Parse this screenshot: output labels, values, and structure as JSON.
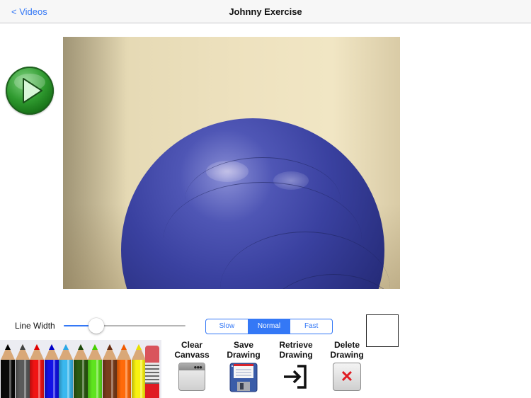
{
  "navbar": {
    "back_label": "< Videos",
    "title": "Johnny Exercise"
  },
  "video": {
    "play_icon": "play-icon",
    "description": "Blue exercise ball against beige wall"
  },
  "controls": {
    "line_width_label": "Line Width",
    "line_width_value": 0.27,
    "speed_options": [
      "Slow",
      "Normal",
      "Fast"
    ],
    "speed_selected": "Normal",
    "current_color": "#ffffff"
  },
  "palette": {
    "pencils": [
      {
        "name": "black",
        "color": "#0a0a0a",
        "tip": "#000000"
      },
      {
        "name": "gray",
        "color": "#5a5a5a",
        "tip": "#444444"
      },
      {
        "name": "red",
        "color": "#f01414",
        "tip": "#e00000"
      },
      {
        "name": "blue",
        "color": "#1212e6",
        "tip": "#0000c8"
      },
      {
        "name": "light-blue",
        "color": "#3ab8ef",
        "tip": "#2aa8e8"
      },
      {
        "name": "dark-green",
        "color": "#2b5a12",
        "tip": "#1e4a0a"
      },
      {
        "name": "light-green",
        "color": "#5ee41e",
        "tip": "#45d000"
      },
      {
        "name": "brown",
        "color": "#7a3c1c",
        "tip": "#6a2e12"
      },
      {
        "name": "orange",
        "color": "#ff6a0a",
        "tip": "#f05a00"
      },
      {
        "name": "yellow",
        "color": "#f8f010",
        "tip": "#e8e000"
      }
    ],
    "eraser_icon": "eraser-icon"
  },
  "actions": [
    {
      "line1": "Clear",
      "line2": "Canvass",
      "icon": "window-icon"
    },
    {
      "line1": "Save",
      "line2": "Drawing",
      "icon": "floppy-disk-icon"
    },
    {
      "line1": "Retrieve",
      "line2": "Drawing",
      "icon": "sign-in-icon"
    },
    {
      "line1": "Delete",
      "line2": "Drawing",
      "icon": "delete-x-icon"
    }
  ]
}
